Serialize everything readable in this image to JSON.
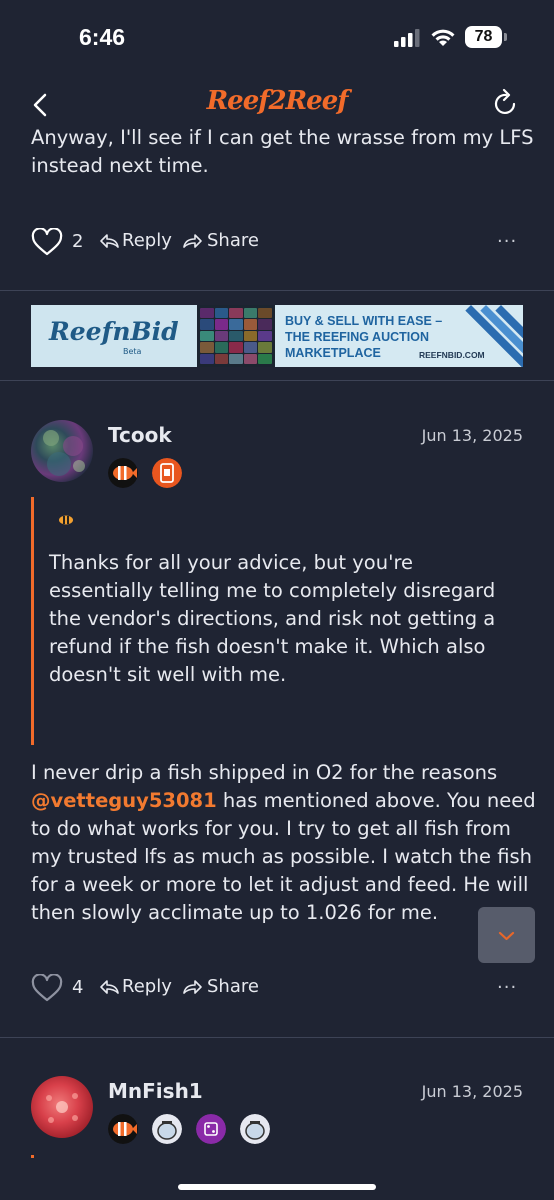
{
  "status_bar": {
    "time": "6:46",
    "battery": "78"
  },
  "nav": {
    "logo": "Reef2Reef"
  },
  "post1": {
    "text_line1": "Anyway, I'll see if I can get the wrasse from my LFS",
    "text_line2": "instead next time.",
    "likes": "2",
    "reply_label": "Reply",
    "share_label": "Share",
    "more_label": "..."
  },
  "banner": {
    "brand": "ReefnBid",
    "brand_sub": "Beta",
    "tagline_1": "BUY & SELL WITH EASE –",
    "tagline_2": "THE REEFING AUCTION",
    "tagline_3": "MARKETPLACE",
    "site": "REEFNBID.COM"
  },
  "post2": {
    "username": "Tcook",
    "date": "Jun 13, 2025",
    "quote_lines": [
      "Thanks for all your advice, but you're",
      "essentially telling me to completely disregard",
      "the vendor's directions, and risk not getting a",
      "refund if the fish doesn't make it. Which also",
      "doesn't sit well with me."
    ],
    "body_line1": "I never drip a fish shipped in O2 for the reasons",
    "mention": "@vetteguy53081",
    "body_line2_rest": " has mentioned above. You need",
    "body_line3": "to do what works for you. I try to get all fish from",
    "body_line4": "my trusted lfs as much as possible. I watch the fish",
    "body_line5": "for a week or more to let it adjust and feed. He will",
    "body_line6": "then slowly acclimate up to 1.026 for me.",
    "likes": "4",
    "reply_label": "Reply",
    "share_label": "Share",
    "more_label": "..."
  },
  "post3": {
    "username": "MnFish1",
    "date": "Jun 13, 2025"
  },
  "colors": {
    "accent": "#f26b2a",
    "background": "#1f2433",
    "text": "#e7e9ef",
    "divider": "#3d4356"
  },
  "icons": [
    "signal-icon",
    "wifi-icon",
    "battery-icon",
    "back-icon",
    "reload-icon",
    "heart-icon",
    "reply-icon",
    "share-icon",
    "more-icon",
    "clownfish-badge",
    "phone-badge",
    "fishbowl-badge",
    "chevron-down-icon"
  ]
}
